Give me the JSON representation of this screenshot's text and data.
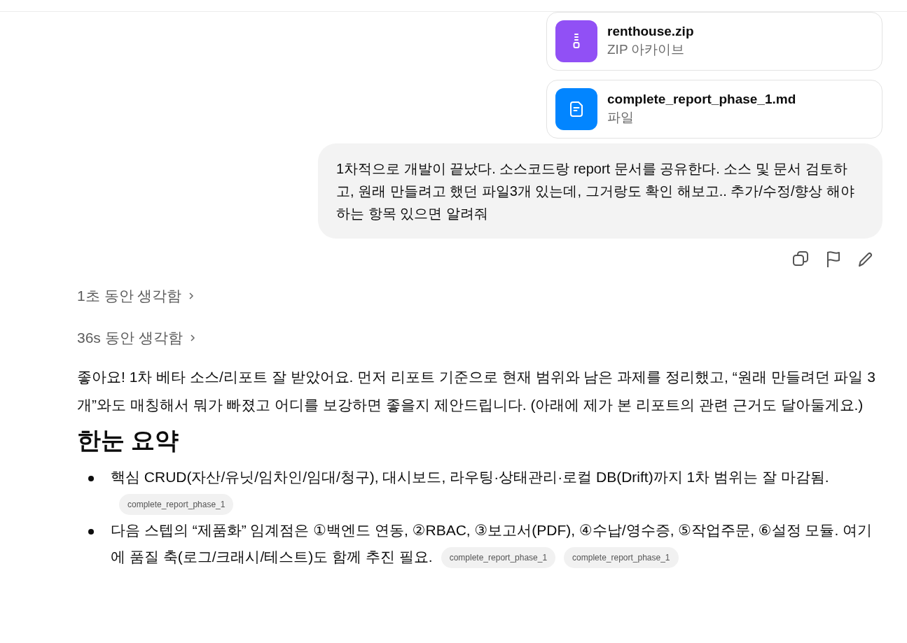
{
  "attachments": [
    {
      "kind": "zip",
      "name": "renthouse.zip",
      "type_label": "ZIP 아카이브"
    },
    {
      "kind": "doc",
      "name": "complete_report_phase_1.md",
      "type_label": "파일"
    }
  ],
  "user_message": "1차적으로 개발이 끝났다. 소스코드랑 report 문서를 공유한다. 소스 및 문서 검토하고, 원래 만들려고 했던 파일3개 있는데, 그거랑도 확인 해보고.. 추가/수정/향상 해야 하는 항목 있으면 알려줘",
  "thinking": [
    {
      "label": "1초 동안 생각함"
    },
    {
      "label": "36s 동안 생각함"
    }
  ],
  "response": {
    "intro": "좋아요! 1차 베타 소스/리포트 잘 받았어요. 먼저 리포트 기준으로 현재 범위와 남은 과제를 정리했고, “원래 만들려던 파일 3개”와도 매칭해서 뭐가 빠졌고 어디를 보강하면 좋을지 제안드립니다. (아래에 제가 본 리포트의 관련 근거도 달아둘게요.)",
    "heading": "한눈 요약",
    "bullets": [
      {
        "text": "핵심 CRUD(자산/유닛/임차인/임대/청구), 대시보드, 라우팅·상태관리·로컬 DB(Drift)까지 1차 범위는 잘 마감됨.",
        "citations": [
          "complete_report_phase_1"
        ]
      },
      {
        "text": "다음 스텝의 “제품화” 임계점은 ①백엔드 연동, ②RBAC, ③보고서(PDF), ④수납/영수증, ⑤작업주문, ⑥설정 모듈. 여기에 품질 축(로그/크래시/테스트)도 함께 추진 필요.",
        "citations": [
          "complete_report_phase_1",
          "complete_report_phase_1"
        ]
      }
    ]
  }
}
